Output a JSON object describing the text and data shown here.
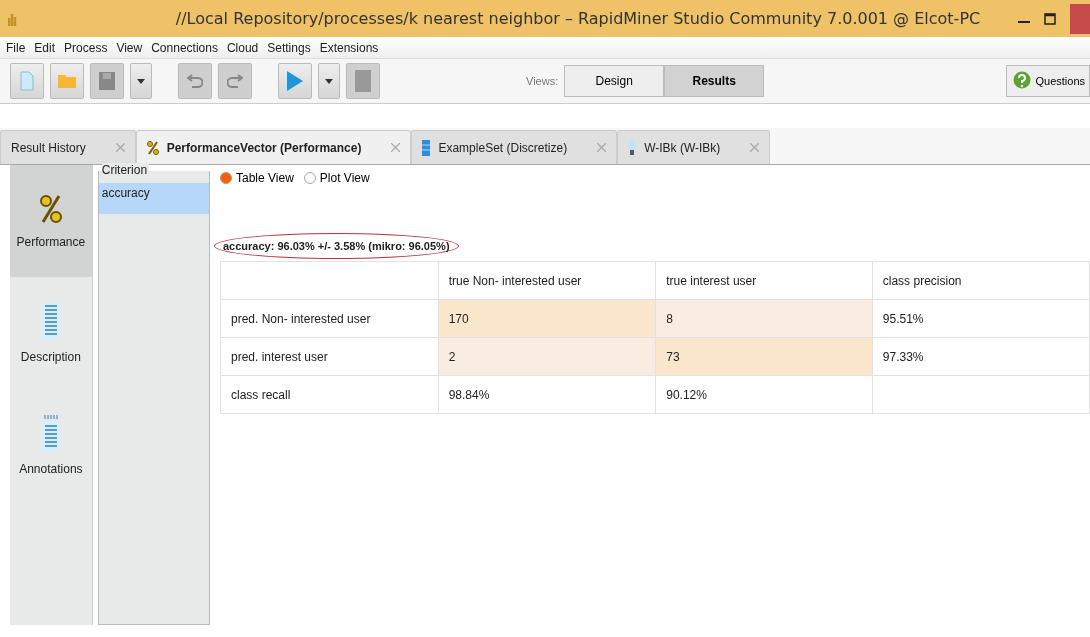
{
  "window": {
    "title": "//Local Repository/processes/k nearest neighbor – RapidMiner Studio Community 7.0.001 @ Elcot-PC"
  },
  "menu": [
    "File",
    "Edit",
    "Process",
    "View",
    "Connections",
    "Cloud",
    "Settings",
    "Extensions"
  ],
  "views": {
    "label": "Views:",
    "buttons": [
      {
        "label": "Design",
        "selected": false
      },
      {
        "label": "Results",
        "selected": true
      }
    ]
  },
  "help_button": "Questions",
  "tabs": [
    {
      "label": "Result History",
      "kind": "history",
      "selected": false
    },
    {
      "label": "PerformanceVector (Performance)",
      "kind": "performance",
      "selected": true
    },
    {
      "label": "ExampleSet (Discretize)",
      "kind": "table",
      "selected": false
    },
    {
      "label": "W-IBk (W-IBk)",
      "kind": "model",
      "selected": false
    }
  ],
  "sidebar": [
    {
      "label": "Performance",
      "kind": "percent",
      "selected": true
    },
    {
      "label": "Description",
      "kind": "document",
      "selected": false
    },
    {
      "label": "Annotations",
      "kind": "notes",
      "selected": false
    }
  ],
  "criterion": {
    "title": "Criterion",
    "items": [
      {
        "label": "accuracy",
        "selected": true
      }
    ]
  },
  "view_mode": [
    {
      "label": "Table View",
      "selected": true
    },
    {
      "label": "Plot View",
      "selected": false
    }
  ],
  "summary": "accuracy: 96.03% +/- 3.58% (mikro: 96.05%)",
  "table": {
    "columns": [
      "",
      "true Non- interested user",
      "true interest user",
      "class precision"
    ],
    "rows": [
      [
        {
          "text": "pred. Non- interested user",
          "kind": "plain"
        },
        {
          "text": "170",
          "kind": "diagonal"
        },
        {
          "text": "8",
          "kind": "offdiagonal"
        },
        {
          "text": "95.51%",
          "kind": "plain"
        }
      ],
      [
        {
          "text": "pred. interest user",
          "kind": "plain"
        },
        {
          "text": "2",
          "kind": "offdiagonal"
        },
        {
          "text": "73",
          "kind": "diagonal"
        },
        {
          "text": "97.33%",
          "kind": "plain"
        }
      ],
      [
        {
          "text": "class recall",
          "kind": "plain"
        },
        {
          "text": "98.84%",
          "kind": "plain"
        },
        {
          "text": "90.12%",
          "kind": "plain"
        },
        {
          "kind": "plain"
        }
      ]
    ]
  }
}
